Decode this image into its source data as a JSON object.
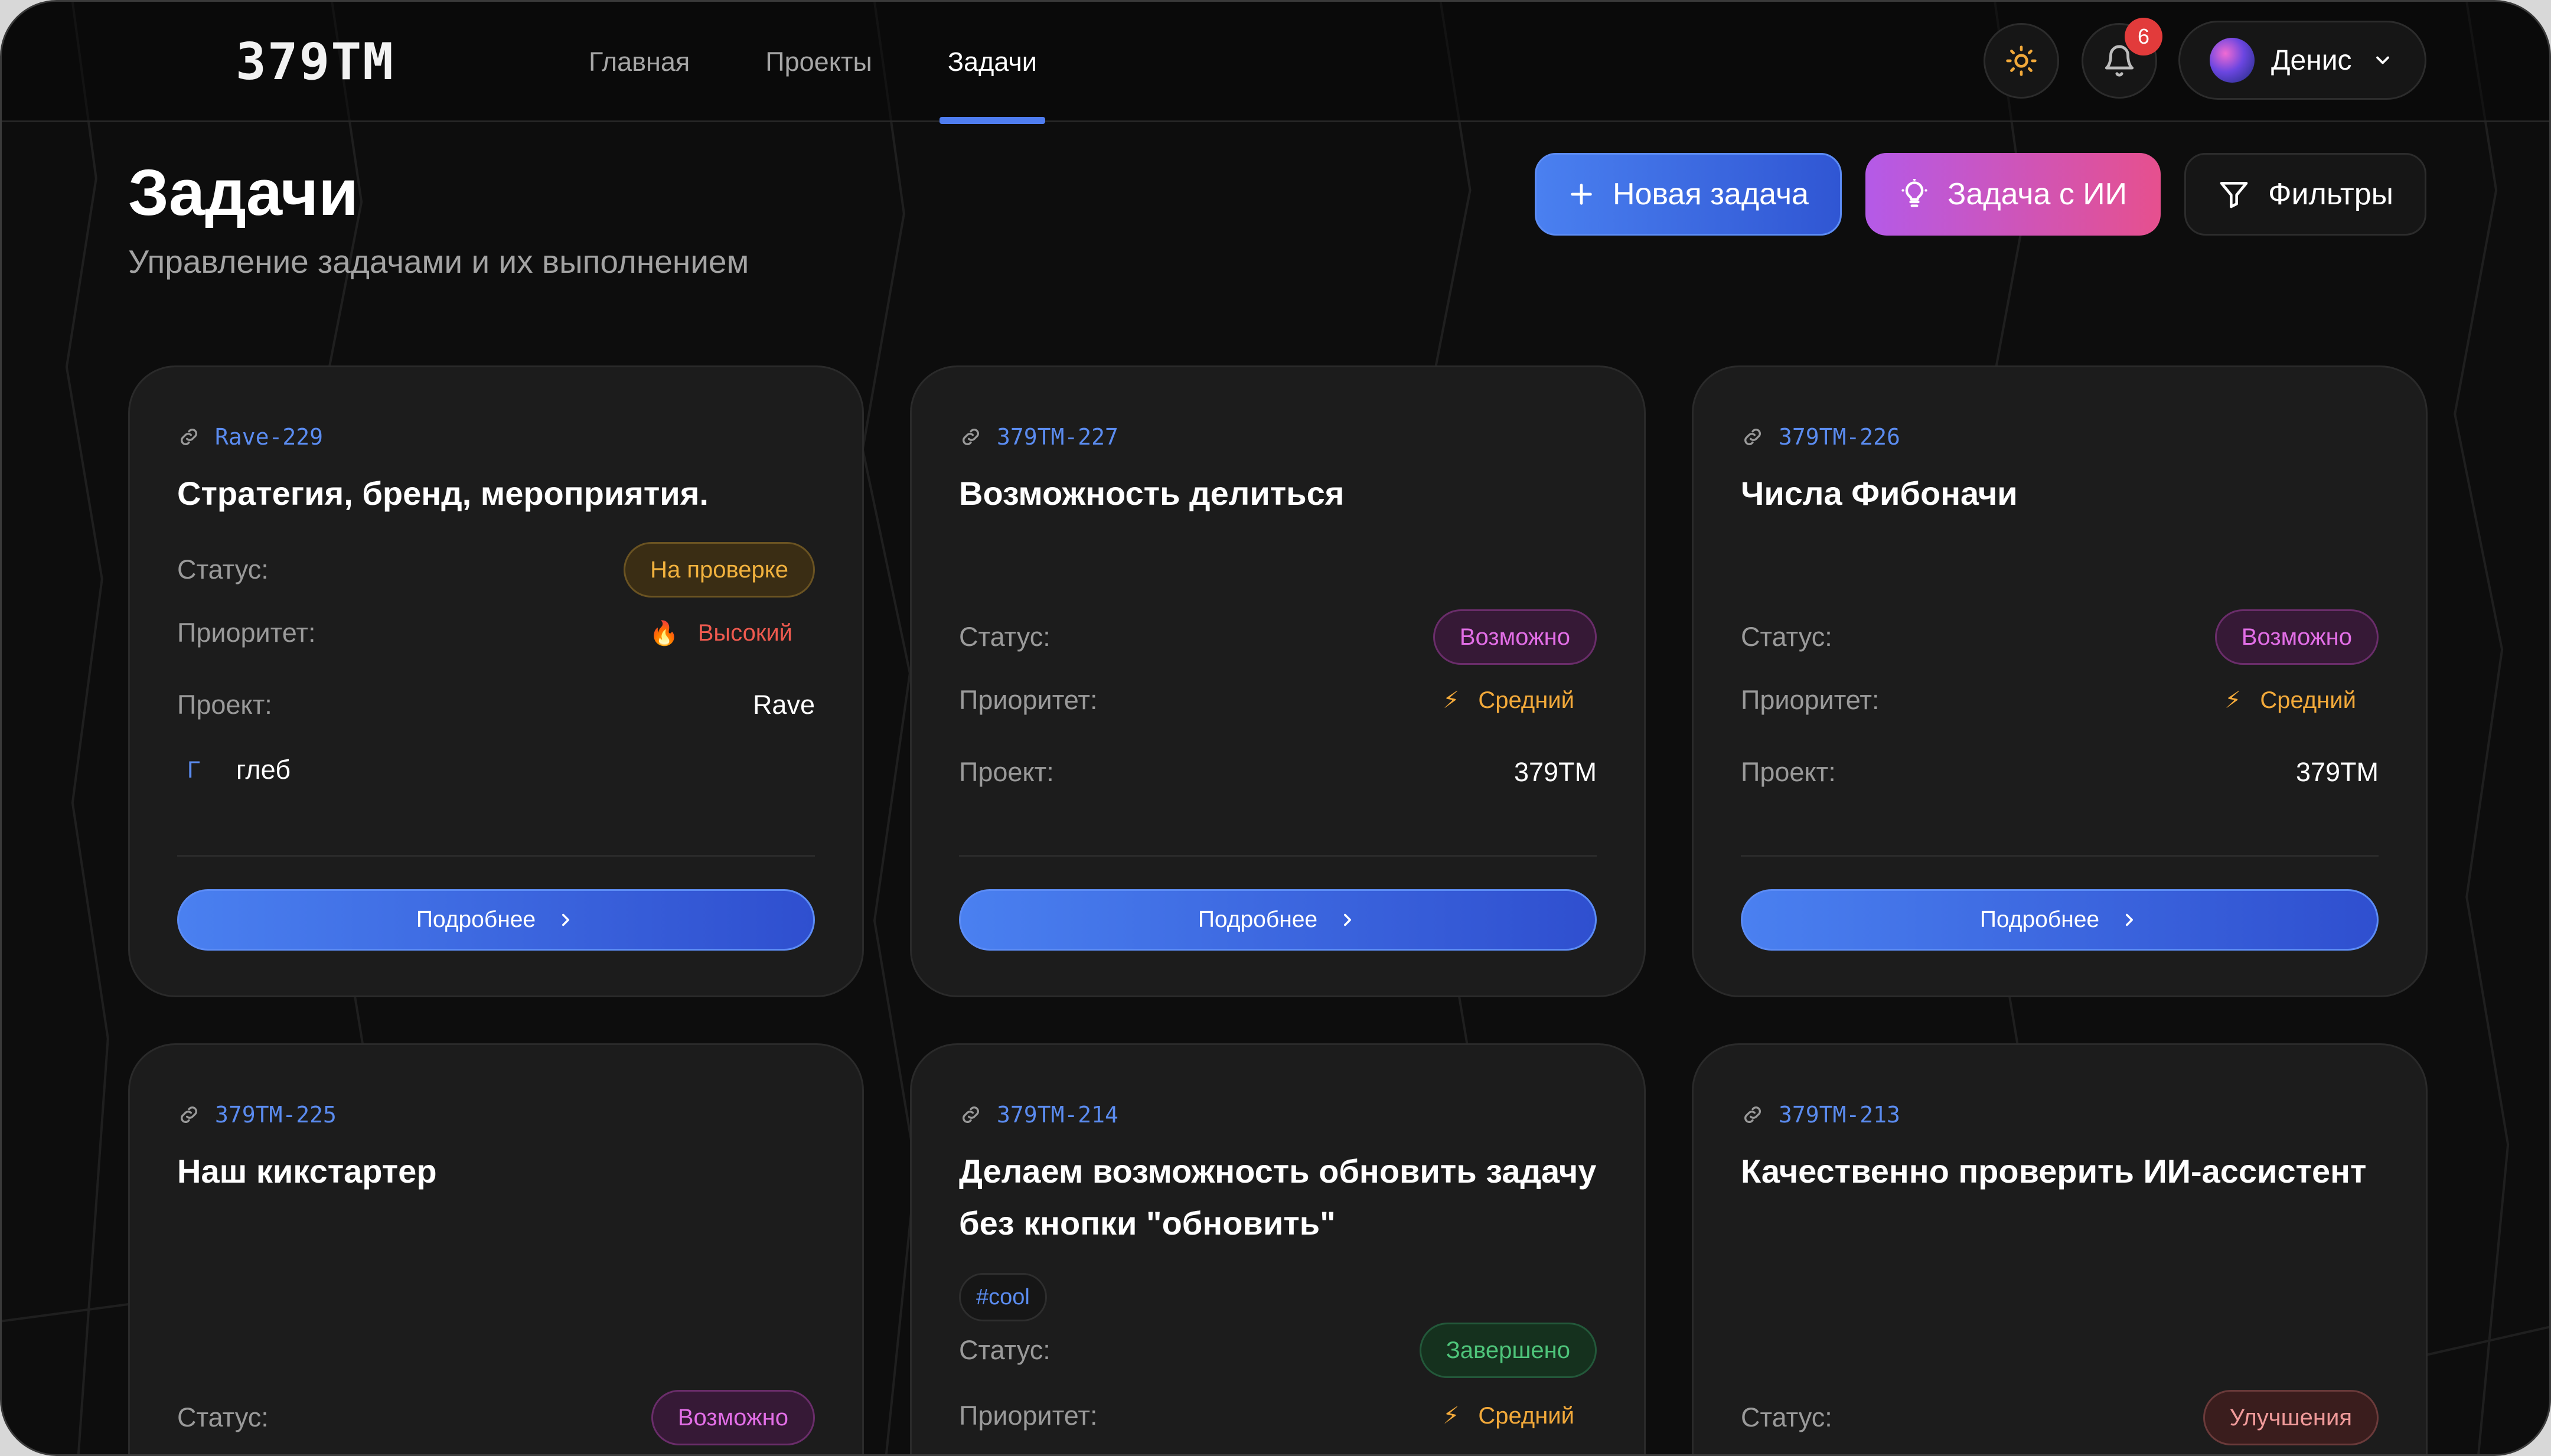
{
  "app": {
    "logo": "379TM"
  },
  "nav": {
    "items": [
      "Главная",
      "Проекты",
      "Задачи"
    ],
    "active": "Задачи"
  },
  "header_controls": {
    "notifications_count": "6",
    "user_name": "Денис"
  },
  "page": {
    "title": "Задачи",
    "subtitle": "Управление задачами и их выполнением",
    "buttons": {
      "new_task": "Новая задача",
      "ai_task": "Задача с ИИ",
      "filters": "Фильтры"
    }
  },
  "labels": {
    "status": "Статус:",
    "priority": "Приоритет:",
    "project": "Проект:",
    "details": "Подробнее"
  },
  "tasks": [
    {
      "id": "Rave-229",
      "title": "Стратегия, бренд, мероприятия.",
      "status": "На проверке",
      "priority": "Высокий",
      "project": "Rave",
      "assignee_initial": "Г",
      "assignee": "глеб"
    },
    {
      "id": "379TM-227",
      "title": "Возможность делиться",
      "status": "Возможно",
      "priority": "Средний",
      "project": "379TM"
    },
    {
      "id": "379TM-226",
      "title": "Числа Фибоначи",
      "status": "Возможно",
      "priority": "Средний",
      "project": "379TM"
    },
    {
      "id": "379TM-225",
      "title": "Наш кикстартер",
      "status": "Возможно"
    },
    {
      "id": "379TM-214",
      "title": "Делаем возможность обновить задачу без кнопки \"обновить\"",
      "tag": "#cool",
      "status": "Завершено",
      "priority": "Средний"
    },
    {
      "id": "379TM-213",
      "title": "Качественно проверить ИИ-ассистент",
      "status": "Улучшения"
    }
  ],
  "colors": {
    "accent": "#4f7df0",
    "ai_gradient_start": "#b45ae8",
    "ai_gradient_end": "#e6508e",
    "badge": "#e23b3b"
  }
}
